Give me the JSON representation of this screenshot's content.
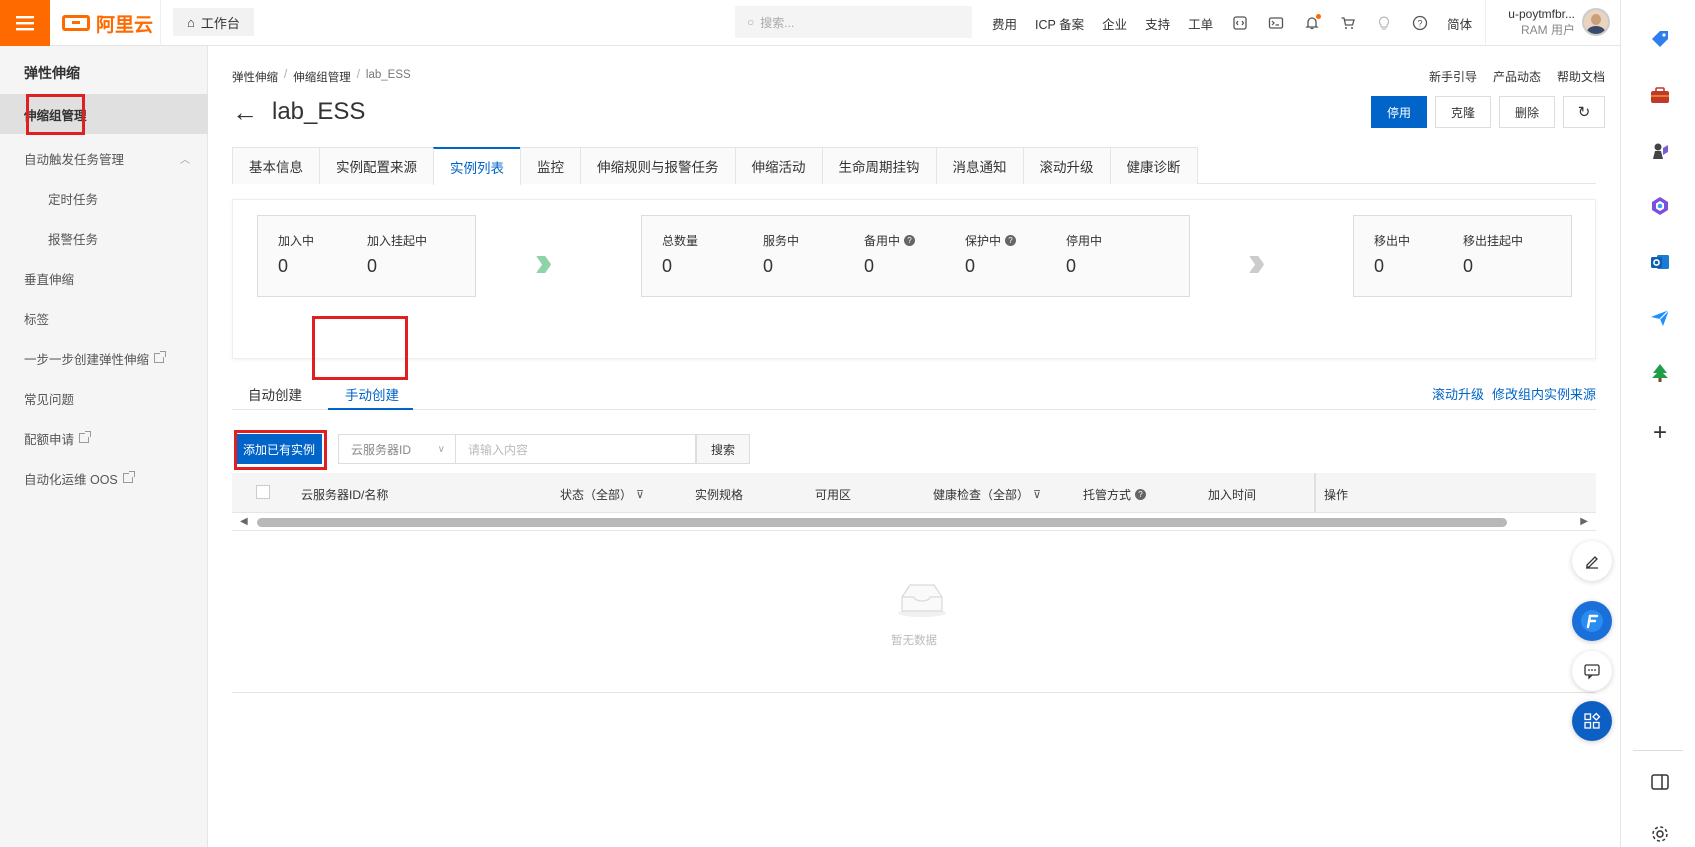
{
  "topbar": {
    "brand": "阿里云",
    "workbench": "工作台",
    "search_placeholder": "搜索...",
    "nav": [
      "费用",
      "ICP 备案",
      "企业",
      "支持",
      "工单"
    ],
    "lang": "简体",
    "user_name": "u-poytmfbr...",
    "user_role": "RAM 用户"
  },
  "sidebar": {
    "title": "弹性伸缩",
    "items": [
      {
        "label": "伸缩组管理"
      },
      {
        "label": "自动触发任务管理"
      },
      {
        "label": "定时任务"
      },
      {
        "label": "报警任务"
      },
      {
        "label": "垂直伸缩"
      },
      {
        "label": "标签"
      },
      {
        "label": "一步一步创建弹性伸缩"
      },
      {
        "label": "常见问题"
      },
      {
        "label": "配额申请"
      },
      {
        "label": "自动化运维 OOS"
      }
    ]
  },
  "breadcrumb": [
    "弹性伸缩",
    "伸缩组管理",
    "lab_ESS"
  ],
  "help_links": [
    "新手引导",
    "产品动态",
    "帮助文档"
  ],
  "page": {
    "title": "lab_ESS",
    "actions": {
      "disable": "停用",
      "clone": "克隆",
      "delete": "删除"
    }
  },
  "tabs": [
    "基本信息",
    "实例配置来源",
    "实例列表",
    "监控",
    "伸缩规则与报警任务",
    "伸缩活动",
    "生命周期挂钩",
    "消息通知",
    "滚动升级",
    "健康诊断"
  ],
  "active_tab": "实例列表",
  "stats": {
    "group1": [
      {
        "label": "加入中",
        "value": "0"
      },
      {
        "label": "加入挂起中",
        "value": "0"
      }
    ],
    "group2": [
      {
        "label": "总数量",
        "value": "0"
      },
      {
        "label": "服务中",
        "value": "0"
      },
      {
        "label": "备用中",
        "value": "0"
      },
      {
        "label": "保护中",
        "value": "0"
      },
      {
        "label": "停用中",
        "value": "0"
      }
    ],
    "group3": [
      {
        "label": "移出中",
        "value": "0"
      },
      {
        "label": "移出挂起中",
        "value": "0"
      }
    ]
  },
  "subtabs": {
    "auto": "自动创建",
    "manual": "手动创建",
    "active": "手动创建"
  },
  "subtab_links": [
    "滚动升级",
    "修改组内实例来源"
  ],
  "toolbar": {
    "add_button": "添加已有实例",
    "select_value": "云服务器ID",
    "input_placeholder": "请输入内容",
    "search_button": "搜索"
  },
  "table": {
    "headers": [
      "云服务器ID/名称",
      "状态（全部）",
      "实例规格",
      "可用区",
      "健康检查（全部）",
      "托管方式",
      "加入时间",
      "操作"
    ],
    "empty_text": "暂无数据"
  },
  "colors": {
    "brand": "#ff6a00",
    "primary": "#0064c8",
    "highlight": "#e02020",
    "success_arrow": "#8fd4a6",
    "muted_arrow": "#cccccc"
  }
}
